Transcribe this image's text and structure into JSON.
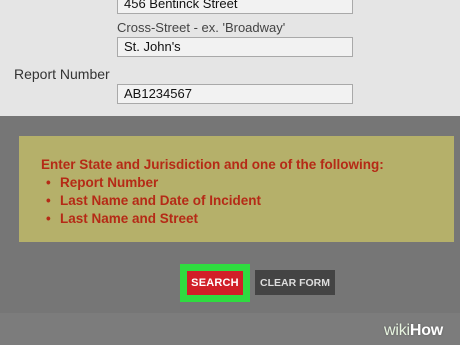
{
  "form": {
    "street_value": "456 Bentinck Street",
    "cross_street_label": "Cross-Street - ex. 'Broadway'",
    "cross_street_value": "St. John's",
    "report_number_label": "Report Number",
    "report_number_value": "AB1234567"
  },
  "notice": {
    "title": "Enter State and Jurisdiction and one of the following:",
    "items": [
      "Report Number",
      "Last Name and Date of Incident",
      "Last Name and Street"
    ]
  },
  "buttons": {
    "search_label": "SEARCH",
    "clear_label": "CLEAR FORM"
  },
  "watermark": {
    "prefix": "wiki",
    "suffix": "How"
  },
  "colors": {
    "notice_bg": "#b5b06a",
    "notice_text": "#b52a16",
    "search_bg": "#d11f28",
    "highlight": "#2fdc40",
    "clear_bg": "#444444"
  }
}
